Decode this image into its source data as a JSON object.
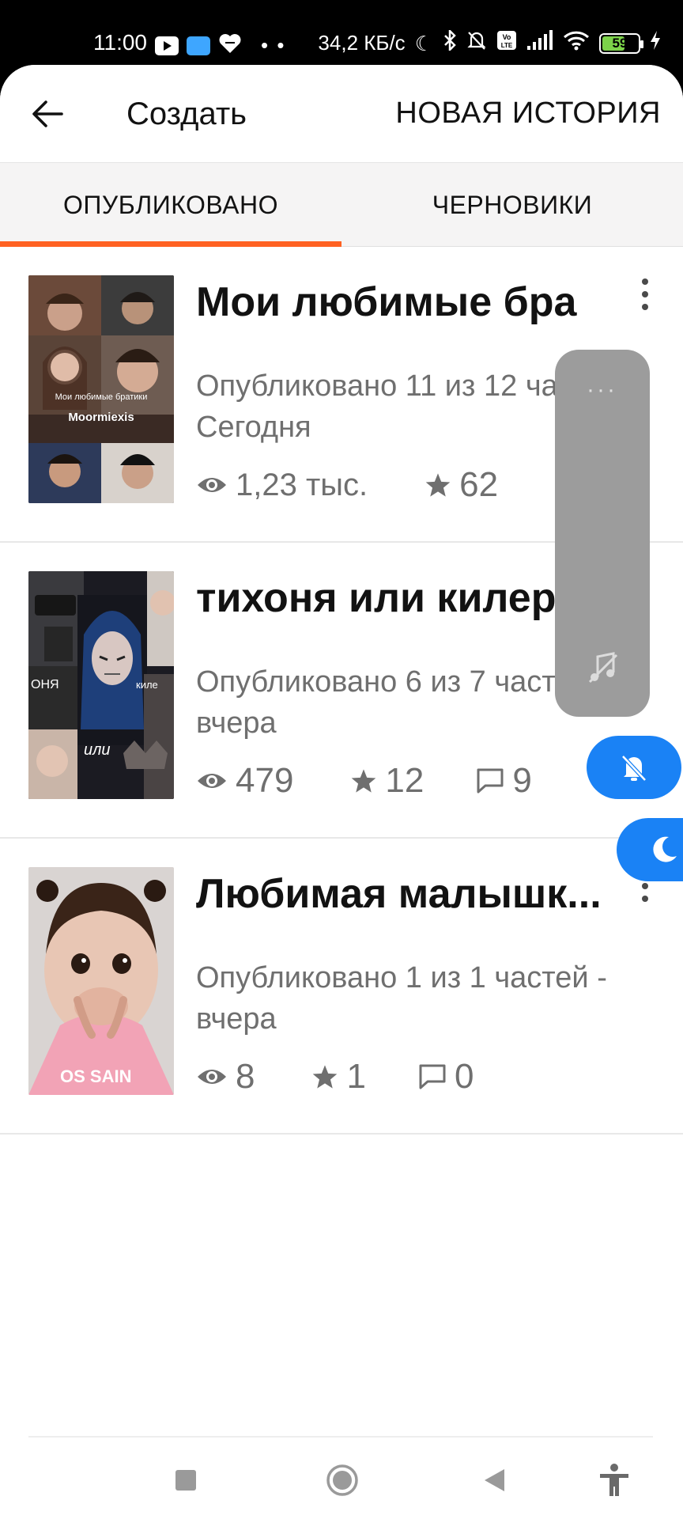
{
  "status_bar": {
    "time": "11:00",
    "network_speed": "34,2 КБ/с",
    "battery": "59",
    "icons": [
      "youtube-icon",
      "app-icon",
      "heart-icon",
      "moon-icon",
      "bluetooth-icon",
      "bell-off-icon",
      "volte-icon",
      "signal-icon",
      "wifi-icon",
      "battery-icon",
      "charging-icon"
    ]
  },
  "app_bar": {
    "title": "Создать",
    "action_label": "НОВАЯ ИСТОРИЯ"
  },
  "tabs": [
    {
      "label": "ОПУБЛИКОВАНО",
      "active": true
    },
    {
      "label": "ЧЕРНОВИКИ",
      "active": false
    }
  ],
  "accent_color": "#ff6122",
  "stories": [
    {
      "title": "Мои любимые бра",
      "subtitle": "Опубликовано 11 из 12 частей - Сегодня",
      "views": "1,23 тыс.",
      "votes": "62",
      "comments": "",
      "cover_texts": [
        "Мои любимые братики",
        "Moormiexis"
      ]
    },
    {
      "title": "тихоня или килер",
      "subtitle": "Опубликовано 6 из 7 частей - вчера",
      "views": "479",
      "votes": "12",
      "comments": "9",
      "cover_texts": [
        "ОНЯ",
        "киле",
        "или"
      ]
    },
    {
      "title": "Любимая малышк...",
      "subtitle": "Опубликовано 1 из 1 частей - вчера",
      "views": "8",
      "votes": "1",
      "comments": "0",
      "cover_texts": [
        "OS SAIN"
      ]
    }
  ],
  "floating_panel": {
    "dots": "···",
    "color": "#9c9c9c",
    "button_color": "#1a82f5"
  },
  "nav_bar": {
    "buttons": [
      "recents-square-icon",
      "home-circle-icon",
      "back-triangle-icon",
      "accessibility-icon"
    ]
  }
}
